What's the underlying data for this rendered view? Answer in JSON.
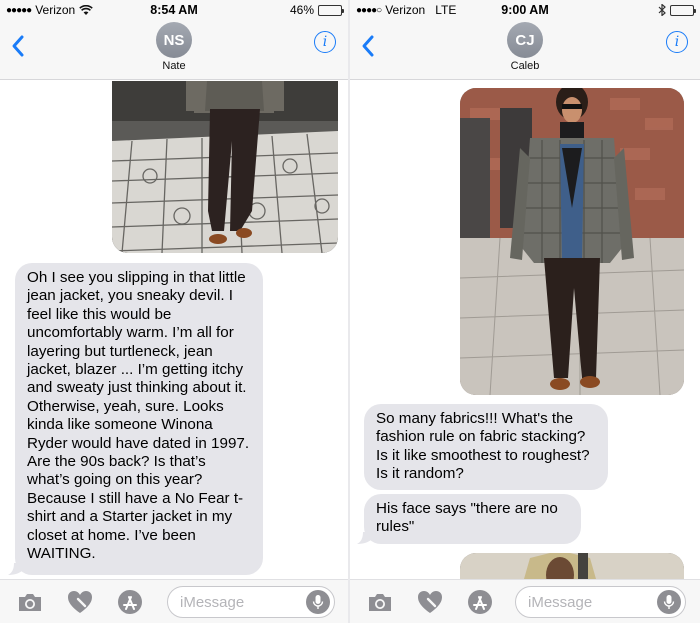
{
  "left": {
    "status": {
      "carrier": "Verizon",
      "time": "8:54 AM",
      "battery_text": "46%",
      "battery_level": 0.46,
      "battery_color": "#f5c400"
    },
    "contact": {
      "initials": "NS",
      "name": "Nate"
    },
    "messages": [
      {
        "text": "Oh I see you slipping in that little jean jacket, you sneaky devil. I feel like this would be uncomfortably warm. I’m all for layering but turtleneck, jean jacket, blazer ... I’m getting itchy and sweaty just thinking about it. Otherwise, yeah, sure. Looks kinda like someone Winona Ryder would have dated in 1997. Are the 90s back? Is that’s what’s going on this year? Because I still have a No Fear t-shirt and a Starter jacket in my closet at home. I’ve been WAITING."
      }
    ],
    "input_placeholder": "iMessage"
  },
  "right": {
    "status": {
      "carrier": "Verizon",
      "network": "LTE",
      "time": "9:00 AM",
      "battery_level": 0.25,
      "battery_color": "#111111"
    },
    "contact": {
      "initials": "CJ",
      "name": "Caleb"
    },
    "messages": [
      {
        "text": "So many fabrics!!! What's the fashion rule on fabric stacking? Is it like smoothest to roughest? Is it random?"
      },
      {
        "text": "His face says \"there are no rules\""
      }
    ],
    "input_placeholder": "iMessage"
  },
  "colors": {
    "accent": "#1a7cf8",
    "bubble_gray": "#e5e5ea",
    "nav_bg": "#f7f7f7"
  },
  "icons": [
    "back-chevron-icon",
    "info-icon",
    "camera-icon",
    "digital-touch-heart-icon",
    "app-store-icon",
    "microphone-icon",
    "wifi-icon",
    "bluetooth-icon"
  ]
}
